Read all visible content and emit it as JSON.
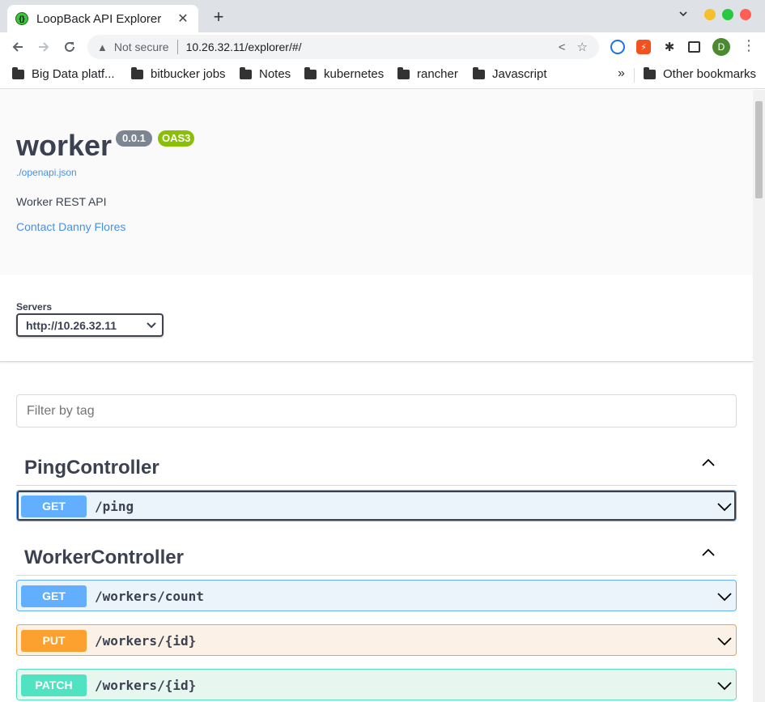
{
  "browser": {
    "tab_title": "LoopBack API Explorer",
    "tab_close": "✕",
    "new_tab": "+",
    "security_label": "Not secure",
    "url": "10.26.32.11/explorer/#/",
    "avatar_initial": "D",
    "bookmarks": [
      {
        "label": "Big Data platf..."
      },
      {
        "label": "bitbucker jobs"
      },
      {
        "label": "Notes"
      },
      {
        "label": "kubernetes"
      },
      {
        "label": "rancher"
      },
      {
        "label": "Javascript"
      }
    ],
    "bookmarks_overflow": "»",
    "other_bookmarks": "Other bookmarks"
  },
  "info": {
    "title": "worker",
    "version": "0.0.1",
    "oas_badge": "OAS3",
    "spec_link": "./openapi.json",
    "description": "Worker REST API",
    "contact": "Contact Danny Flores"
  },
  "servers": {
    "label": "Servers",
    "selected": "http://10.26.32.11"
  },
  "filter": {
    "placeholder": "Filter by tag"
  },
  "tags": [
    {
      "name": "PingController",
      "operations": [
        {
          "method": "GET",
          "path": "/ping"
        }
      ]
    },
    {
      "name": "WorkerController",
      "operations": [
        {
          "method": "GET",
          "path": "/workers/count"
        },
        {
          "method": "PUT",
          "path": "/workers/{id}"
        },
        {
          "method": "PATCH",
          "path": "/workers/{id}"
        }
      ]
    }
  ],
  "colors": {
    "get": "#61affe",
    "put": "#fca130",
    "patch": "#50e3c2",
    "oas": "#89bf04",
    "link": "#4990e2"
  }
}
